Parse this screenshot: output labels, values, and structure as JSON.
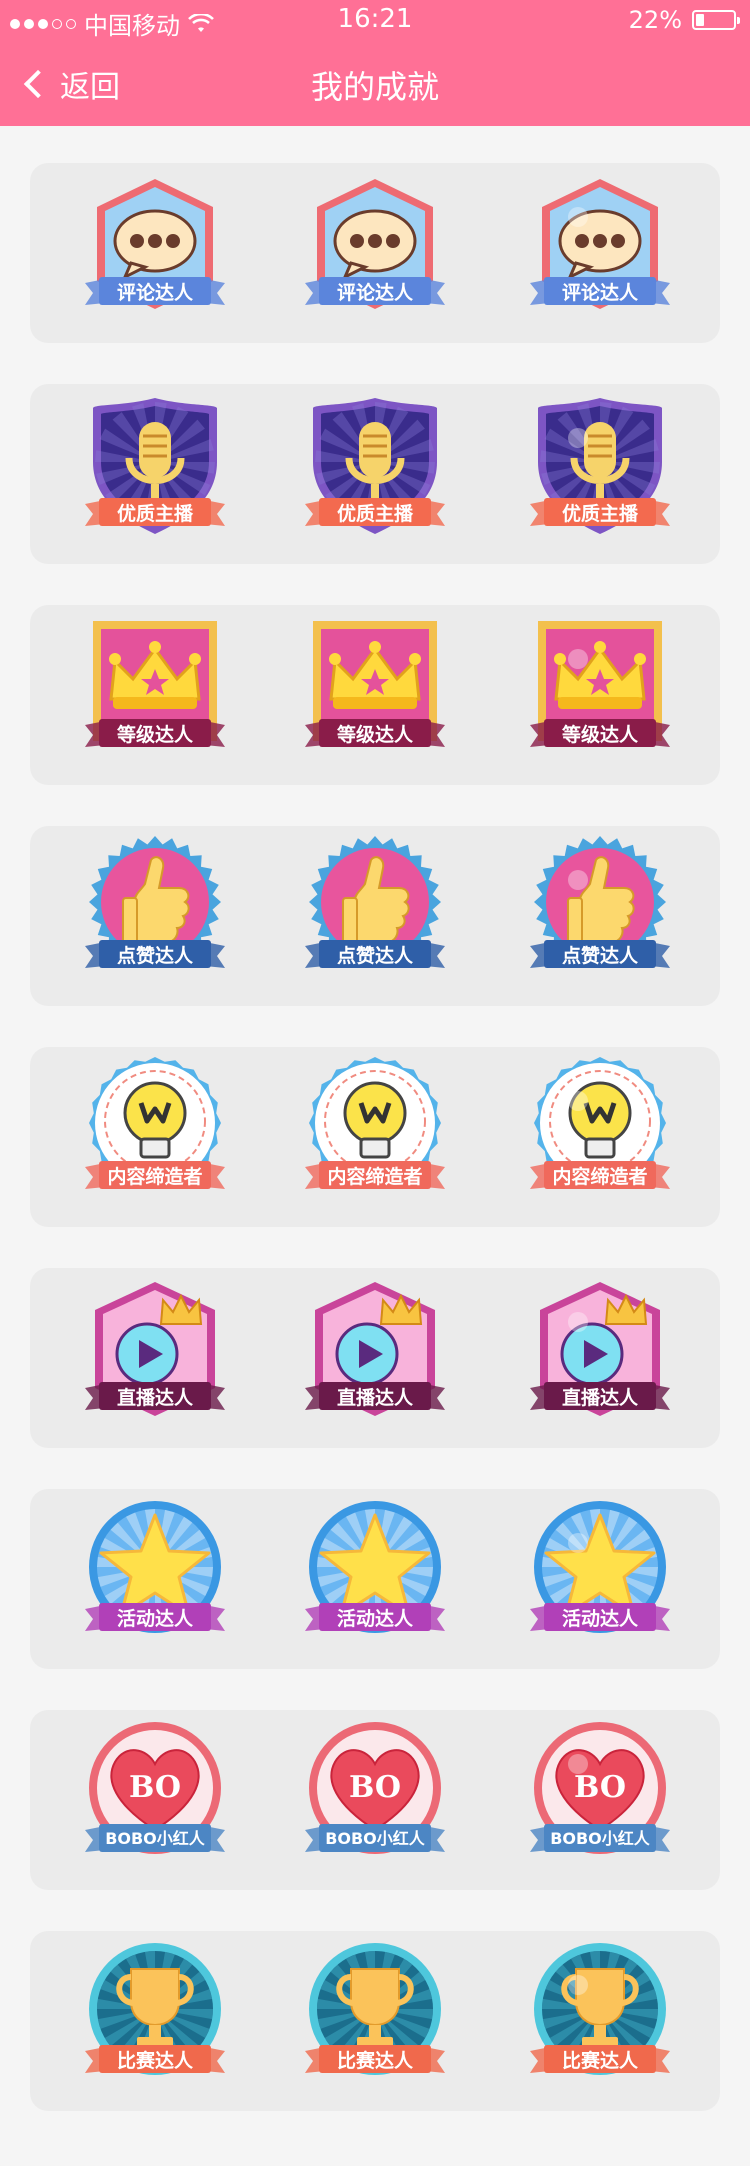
{
  "status_bar": {
    "carrier": "中国移动",
    "time": "16:21",
    "battery": "22%",
    "battery_level": 0.22
  },
  "nav": {
    "back_label": "返回",
    "title": "我的成就"
  },
  "rows": [
    {
      "kind": "comment",
      "label": "评论达人",
      "colors": {
        "rim": "#ee6b72",
        "face": "#9fd1f4",
        "ribbon": "#5b85dc",
        "icon": "#fde6bf",
        "dot": "#6a3c2c"
      }
    },
    {
      "kind": "mic",
      "label": "优质主播",
      "colors": {
        "rim": "#7d55c4",
        "face": "#3a2c8c",
        "ribbon": "#f36a4f",
        "icon": "#f6d36a",
        "dot": "#c98a2b"
      }
    },
    {
      "kind": "crown",
      "label": "等级达人",
      "colors": {
        "rim": "#f3c04d",
        "face": "#e4529b",
        "ribbon": "#8a1c49",
        "icon": "#ffd93d",
        "dot": "#e4529b"
      }
    },
    {
      "kind": "thumb",
      "label": "点赞达人",
      "colors": {
        "rim": "#4aa4de",
        "face": "#e8559d",
        "ribbon": "#2f5fa8",
        "icon": "#fcd86d",
        "dot": "#d69a29"
      }
    },
    {
      "kind": "bulb",
      "label": "内容缔造者",
      "colors": {
        "rim": "#54b3ea",
        "face": "#ffffff",
        "ribbon": "#f0695c",
        "icon": "#fbe34a",
        "dot": "#333333"
      }
    },
    {
      "kind": "live",
      "label": "直播达人",
      "colors": {
        "rim": "#c9449a",
        "face": "#f8b3db",
        "ribbon": "#6a1a4a",
        "icon": "#7fe0f2",
        "dot": "#5a2a7e"
      }
    },
    {
      "kind": "star",
      "label": "活动达人",
      "colors": {
        "rim": "#3a98e3",
        "face": "#6ab6f2",
        "ribbon": "#b140b8",
        "icon": "#ffe04a",
        "dot": "#f6b83a"
      }
    },
    {
      "kind": "heart",
      "label": "BOBO小红人",
      "heart_text": "BO",
      "colors": {
        "rim": "#ec6975",
        "face": "#fbe8eb",
        "ribbon": "#4c86c4",
        "icon": "#ea4a5c",
        "dot": "#ffffff"
      }
    },
    {
      "kind": "trophy",
      "label": "比赛达人",
      "colors": {
        "rim": "#4ec7dc",
        "face": "#1b6e8d",
        "ribbon": "#f0694c",
        "icon": "#fbc35a",
        "dot": "#e39b2b"
      }
    }
  ]
}
